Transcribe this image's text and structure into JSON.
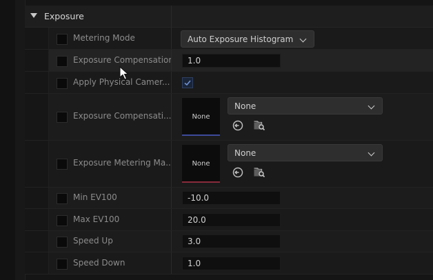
{
  "section": {
    "title": "Exposure"
  },
  "rows": {
    "metering_mode": {
      "label": "Metering Mode",
      "value": "Auto Exposure Histogram"
    },
    "exposure_compensation": {
      "label": "Exposure Compensation",
      "value": "1.0"
    },
    "apply_physical_camera": {
      "label": "Apply Physical Camer...",
      "checked": true
    },
    "exposure_compensation_curve": {
      "label": "Exposure Compensati...",
      "thumb": "None",
      "value": "None"
    },
    "exposure_metering_mask": {
      "label": "Exposure Metering Ma...",
      "thumb": "None",
      "value": "None"
    },
    "min_ev100": {
      "label": "Min EV100",
      "value": "-10.0"
    },
    "max_ev100": {
      "label": "Max EV100",
      "value": "20.0"
    },
    "speed_up": {
      "label": "Speed Up",
      "value": "3.0"
    },
    "speed_down": {
      "label": "Speed Down",
      "value": "1.0"
    }
  },
  "icons": [
    "reset-arrow-icon",
    "browse-folder-icon",
    "checkmark-icon",
    "chevron-down-icon",
    "caret-down-icon"
  ]
}
